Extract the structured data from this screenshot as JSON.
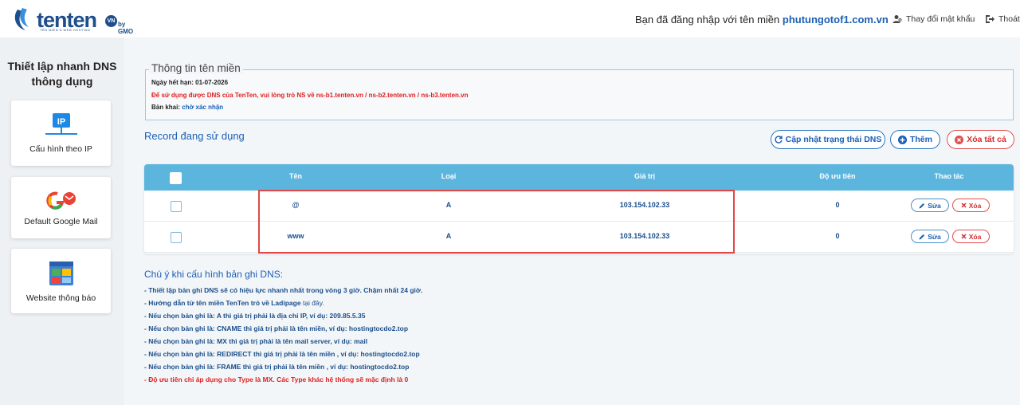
{
  "header": {
    "logo_text": "tenten",
    "logo_badge": "VN",
    "logo_gmo": "by GMO",
    "logo_tagline": "TÊN MIỀN & WEB HOSTING",
    "login_prefix": "Bạn đã đăng nhập với tên miền",
    "login_domain": "phutungotof1.com.vn",
    "change_password": "Thay đổi mật khẩu",
    "logout": "Thoát"
  },
  "sidebar": {
    "title": "Thiết lập nhanh DNS thông dụng",
    "items": [
      {
        "label": "Cấu hình theo IP",
        "icon": "ip-network-icon"
      },
      {
        "label": "Default Google Mail",
        "icon": "google-mail-icon"
      },
      {
        "label": "Website thông báo",
        "icon": "website-icon"
      }
    ]
  },
  "domain_info": {
    "legend": "Thông tin tên miền",
    "expiry": "Ngày hết hạn: 01-07-2026",
    "ns_notice": "Để sử dụng được DNS của TenTen, vui lòng trỏ NS về ns-b1.tenten.vn / ns-b2.tenten.vn / ns-b3.tenten.vn",
    "declaration_label": "Bản khai:",
    "declaration_value": "chờ xác nhận"
  },
  "records": {
    "title": "Record đang sử dụng",
    "btn_refresh": "Cập nhật trạng thái DNS",
    "btn_add": "Thêm",
    "btn_delete_all": "Xóa tất cả",
    "columns": [
      "Tên",
      "Loại",
      "Giá trị",
      "Độ ưu tiên",
      "Thao tác"
    ],
    "rows": [
      {
        "name": "@",
        "type": "A",
        "value": "103.154.102.33",
        "priority": "0"
      },
      {
        "name": "www",
        "type": "A",
        "value": "103.154.102.33",
        "priority": "0"
      }
    ],
    "edit_label": "Sửa",
    "delete_label": "Xóa"
  },
  "notes": {
    "title": "Chú ý khi cấu hình bản ghi DNS:",
    "items": [
      "- Thiết lập bản ghi DNS sẽ có hiệu lực nhanh nhất trong vòng 3 giờ. Chậm nhất 24 giờ.",
      "- Hướng dẫn từ tên miền TenTen trỏ về Ladipage",
      "- Nếu chọn bản ghi là: A thì giá trị phải là địa chỉ IP, ví dụ: 209.85.5.35",
      "- Nếu chọn bản ghi là: CNAME thì giá trị phải là tên miền, ví dụ: hostingtocdo2.top",
      "- Nếu chọn bản ghi là: MX thì giá trị phải là tên mail server, ví dụ: mail",
      "- Nếu chọn bản ghi là: REDIRECT thì giá trị phải là tên miền , ví dụ: hostingtocdo2.top",
      "- Nếu chọn bản ghi là: FRAME thì giá trị phải là tên miền , ví dụ: hostingtocdo2.top",
      "- Độ ưu tiên chỉ áp dụng cho Type là MX. Các Type khác hệ thống sẽ mặc định là 0"
    ],
    "link_text": "tại đây."
  },
  "colors": {
    "brand": "#1e4e8c",
    "link": "#1a5fb4",
    "table_header": "#5bb5dd",
    "danger": "#e02020",
    "highlight": "#e04848"
  }
}
